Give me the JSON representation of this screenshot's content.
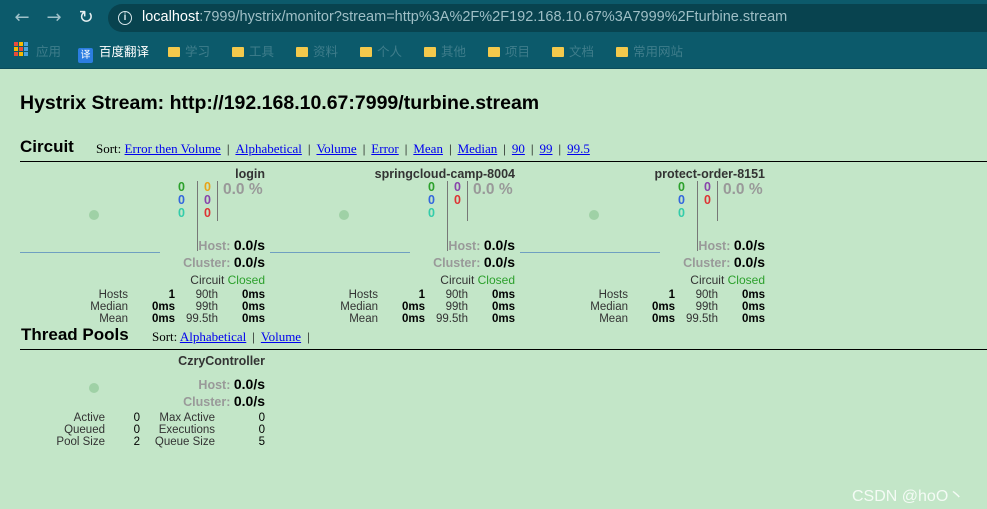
{
  "browser": {
    "url_host": "localhost",
    "url_rest": ":7999/hystrix/monitor?stream=http%3A%2F%2F192.168.10.67%3A7999%2Fturbine.stream",
    "bookmarks": [
      {
        "label": "应用"
      },
      {
        "label": "百度翻译"
      },
      {
        "label": "学习"
      },
      {
        "label": "工具"
      },
      {
        "label": "资料"
      },
      {
        "label": "个人"
      },
      {
        "label": "其他"
      },
      {
        "label": "项目"
      },
      {
        "label": "文档"
      },
      {
        "label": "常用网站"
      }
    ]
  },
  "page": {
    "title": "Hystrix Stream: http://192.168.10.67:7999/turbine.stream"
  },
  "circuit": {
    "heading": "Circuit",
    "sort_label": "Sort:",
    "sort_links": [
      "Error then Volume",
      "Alphabetical",
      "Volume",
      "Error",
      "Mean",
      "Median",
      "90",
      "99",
      "99.5"
    ],
    "monitors": [
      {
        "name": "login",
        "counts_left": [
          "0",
          "0",
          "0"
        ],
        "counts_right": [
          "0",
          "0",
          "0"
        ],
        "error_pct": "0.0 %",
        "host_label": "Host:",
        "host_rate": "0.0/s",
        "cluster_label": "Cluster:",
        "cluster_rate": "0.0/s",
        "circuit_label": "Circuit",
        "circuit_status": "Closed",
        "stats": {
          "hosts_label": "Hosts",
          "hosts": "1",
          "median_label": "Median",
          "median": "0ms",
          "mean_label": "Mean",
          "mean": "0ms",
          "p90_label": "90th",
          "p90": "0ms",
          "p99_label": "99th",
          "p99": "0ms",
          "p995_label": "99.5th",
          "p995": "0ms"
        }
      },
      {
        "name": "springcloud-camp-8004",
        "counts_left": [
          "0",
          "0",
          "0"
        ],
        "counts_right": [
          "0",
          "0"
        ],
        "error_pct": "0.0 %",
        "host_label": "Host:",
        "host_rate": "0.0/s",
        "cluster_label": "Cluster:",
        "cluster_rate": "0.0/s",
        "circuit_label": "Circuit",
        "circuit_status": "Closed",
        "stats": {
          "hosts_label": "Hosts",
          "hosts": "1",
          "median_label": "Median",
          "median": "0ms",
          "mean_label": "Mean",
          "mean": "0ms",
          "p90_label": "90th",
          "p90": "0ms",
          "p99_label": "99th",
          "p99": "0ms",
          "p995_label": "99.5th",
          "p995": "0ms"
        }
      },
      {
        "name": "protect-order-8151",
        "counts_left": [
          "0",
          "0",
          "0"
        ],
        "counts_right": [
          "0",
          "0"
        ],
        "error_pct": "0.0 %",
        "host_label": "Host:",
        "host_rate": "0.0/s",
        "cluster_label": "Cluster:",
        "cluster_rate": "0.0/s",
        "circuit_label": "Circuit",
        "circuit_status": "Closed",
        "stats": {
          "hosts_label": "Hosts",
          "hosts": "1",
          "median_label": "Median",
          "median": "0ms",
          "mean_label": "Mean",
          "mean": "0ms",
          "p90_label": "90th",
          "p90": "0ms",
          "p99_label": "99th",
          "p99": "0ms",
          "p995_label": "99.5th",
          "p995": "0ms"
        }
      }
    ]
  },
  "thread_pools": {
    "heading": "Thread Pools",
    "sort_label": "Sort:",
    "sort_links": [
      "Alphabetical",
      "Volume"
    ],
    "pool": {
      "name": "CzryController",
      "host_label": "Host:",
      "host_rate": "0.0/s",
      "cluster_label": "Cluster:",
      "cluster_rate": "0.0/s",
      "stats": {
        "active_label": "Active",
        "active": "0",
        "queued_label": "Queued",
        "queued": "0",
        "pool_size_label": "Pool Size",
        "pool_size": "2",
        "max_active_label": "Max Active",
        "max_active": "0",
        "executions_label": "Executions",
        "executions": "0",
        "queue_size_label": "Queue Size",
        "queue_size": "5"
      }
    }
  },
  "watermark": "CSDN @hoO丶"
}
